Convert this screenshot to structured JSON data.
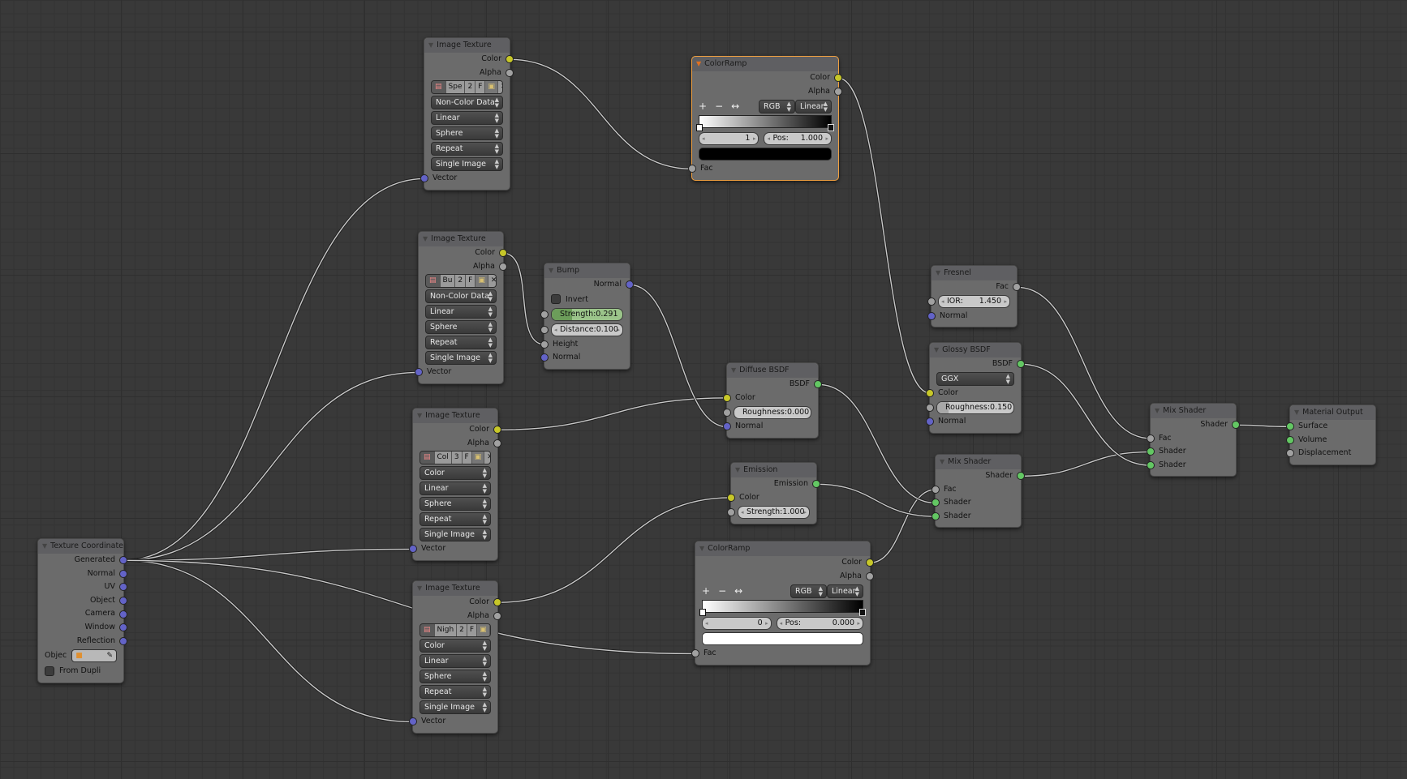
{
  "editor": "Node Editor",
  "socket_colors": {
    "color": "#c7c729",
    "float": "#a1a1a1",
    "vector": "#6363c7",
    "shader": "#63c763"
  },
  "accent_selected": "#f0a040",
  "nodes": [
    {
      "id": "img1",
      "title": "Image Texture",
      "selected": false,
      "rows": [
        {
          "kind": "out",
          "label": "Color",
          "type": "color"
        },
        {
          "kind": "out",
          "label": "Alpha",
          "type": "float"
        },
        {
          "kind": "image",
          "name": "Spe",
          "users": "2",
          "fake": "F"
        },
        {
          "kind": "select",
          "value": "Non-Color Data"
        },
        {
          "kind": "select",
          "value": "Linear"
        },
        {
          "kind": "select",
          "value": "Sphere"
        },
        {
          "kind": "select",
          "value": "Repeat"
        },
        {
          "kind": "select",
          "value": "Single Image"
        },
        {
          "kind": "in",
          "label": "Vector",
          "type": "vector"
        }
      ]
    },
    {
      "id": "img2",
      "title": "Image Texture",
      "selected": false,
      "rows": [
        {
          "kind": "out",
          "label": "Color",
          "type": "color"
        },
        {
          "kind": "out",
          "label": "Alpha",
          "type": "float"
        },
        {
          "kind": "image",
          "name": "Bu",
          "users": "2",
          "fake": "F"
        },
        {
          "kind": "select",
          "value": "Non-Color Data"
        },
        {
          "kind": "select",
          "value": "Linear"
        },
        {
          "kind": "select",
          "value": "Sphere"
        },
        {
          "kind": "select",
          "value": "Repeat"
        },
        {
          "kind": "select",
          "value": "Single Image"
        },
        {
          "kind": "in",
          "label": "Vector",
          "type": "vector"
        }
      ]
    },
    {
      "id": "img3",
      "title": "Image Texture",
      "selected": false,
      "rows": [
        {
          "kind": "out",
          "label": "Color",
          "type": "color"
        },
        {
          "kind": "out",
          "label": "Alpha",
          "type": "float"
        },
        {
          "kind": "image",
          "name": "Col",
          "users": "3",
          "fake": "F"
        },
        {
          "kind": "select",
          "value": "Color"
        },
        {
          "kind": "select",
          "value": "Linear"
        },
        {
          "kind": "select",
          "value": "Sphere"
        },
        {
          "kind": "select",
          "value": "Repeat"
        },
        {
          "kind": "select",
          "value": "Single Image"
        },
        {
          "kind": "in",
          "label": "Vector",
          "type": "vector"
        }
      ]
    },
    {
      "id": "img4",
      "title": "Image Texture",
      "selected": false,
      "rows": [
        {
          "kind": "out",
          "label": "Color",
          "type": "color"
        },
        {
          "kind": "out",
          "label": "Alpha",
          "type": "float"
        },
        {
          "kind": "image",
          "name": "Nigh",
          "users": "2",
          "fake": "F"
        },
        {
          "kind": "select",
          "value": "Color"
        },
        {
          "kind": "select",
          "value": "Linear"
        },
        {
          "kind": "select",
          "value": "Sphere"
        },
        {
          "kind": "select",
          "value": "Repeat"
        },
        {
          "kind": "select",
          "value": "Single Image"
        },
        {
          "kind": "in",
          "label": "Vector",
          "type": "vector"
        }
      ]
    },
    {
      "id": "texcoord",
      "title": "Texture Coordinate",
      "selected": false,
      "rows": [
        {
          "kind": "out",
          "label": "Generated",
          "type": "vector"
        },
        {
          "kind": "out",
          "label": "Normal",
          "type": "vector"
        },
        {
          "kind": "out",
          "label": "UV",
          "type": "vector"
        },
        {
          "kind": "out",
          "label": "Object",
          "type": "vector"
        },
        {
          "kind": "out",
          "label": "Camera",
          "type": "vector"
        },
        {
          "kind": "out",
          "label": "Window",
          "type": "vector"
        },
        {
          "kind": "out",
          "label": "Reflection",
          "type": "vector"
        },
        {
          "kind": "object",
          "label": "Objec"
        },
        {
          "kind": "check",
          "label": "From Dupli",
          "checked": false
        }
      ]
    },
    {
      "id": "bump",
      "title": "Bump",
      "selected": false,
      "rows": [
        {
          "kind": "out",
          "label": "Normal",
          "type": "vector"
        },
        {
          "kind": "check",
          "label": "Invert",
          "checked": false
        },
        {
          "kind": "field",
          "label": "Strength:",
          "value": "0.291",
          "style": "slider",
          "fraction": 0.291,
          "highlight": true,
          "type": "float"
        },
        {
          "kind": "field",
          "label": "Distance:",
          "value": "0.100",
          "style": "number",
          "type": "float"
        },
        {
          "kind": "in",
          "label": "Height",
          "type": "float"
        },
        {
          "kind": "in",
          "label": "Normal",
          "type": "vector"
        }
      ]
    },
    {
      "id": "ramp1",
      "title": "ColorRamp",
      "selected": true,
      "rows": [
        {
          "kind": "out",
          "label": "Color",
          "type": "color"
        },
        {
          "kind": "out",
          "label": "Alpha",
          "type": "float"
        },
        {
          "kind": "ramp",
          "plus": "+",
          "minus": "−",
          "flip": "↔",
          "color_mode": "RGB",
          "interpolation": "Linear",
          "active_stop": "1",
          "pos_label": "Pos:",
          "pos": "1.000",
          "active_color": "#000000",
          "stops": [
            {
              "pos": 0,
              "color": "#ffffff"
            },
            {
              "pos": 1,
              "color": "#000000"
            }
          ]
        },
        {
          "kind": "in",
          "label": "Fac",
          "type": "float"
        }
      ]
    },
    {
      "id": "ramp2",
      "title": "ColorRamp",
      "selected": false,
      "rows": [
        {
          "kind": "out",
          "label": "Color",
          "type": "color"
        },
        {
          "kind": "out",
          "label": "Alpha",
          "type": "float"
        },
        {
          "kind": "ramp",
          "plus": "+",
          "minus": "−",
          "flip": "↔",
          "color_mode": "RGB",
          "interpolation": "Linear",
          "active_stop": "0",
          "pos_label": "Pos:",
          "pos": "0.000",
          "active_color": "#ffffff",
          "stops": [
            {
              "pos": 0,
              "color": "#ffffff"
            },
            {
              "pos": 1,
              "color": "#000000"
            }
          ]
        },
        {
          "kind": "in",
          "label": "Fac",
          "type": "float"
        }
      ]
    },
    {
      "id": "diffuse",
      "title": "Diffuse BSDF",
      "selected": false,
      "rows": [
        {
          "kind": "out",
          "label": "BSDF",
          "type": "shader"
        },
        {
          "kind": "in",
          "label": "Color",
          "type": "color"
        },
        {
          "kind": "field",
          "label": "Roughness:",
          "value": "0.000",
          "style": "slider",
          "fraction": 0.0,
          "type": "float"
        },
        {
          "kind": "in",
          "label": "Normal",
          "type": "vector"
        }
      ]
    },
    {
      "id": "emission",
      "title": "Emission",
      "selected": false,
      "rows": [
        {
          "kind": "out",
          "label": "Emission",
          "type": "shader"
        },
        {
          "kind": "in",
          "label": "Color",
          "type": "color"
        },
        {
          "kind": "field",
          "label": "Strength:",
          "value": "1.000",
          "style": "number",
          "type": "float"
        }
      ]
    },
    {
      "id": "fresnel",
      "title": "Fresnel",
      "selected": false,
      "rows": [
        {
          "kind": "out",
          "label": "Fac",
          "type": "float"
        },
        {
          "kind": "field",
          "label": "IOR:",
          "value": "1.450",
          "style": "number",
          "type": "float"
        },
        {
          "kind": "in",
          "label": "Normal",
          "type": "vector"
        }
      ]
    },
    {
      "id": "glossy",
      "title": "Glossy BSDF",
      "selected": false,
      "rows": [
        {
          "kind": "out",
          "label": "BSDF",
          "type": "shader"
        },
        {
          "kind": "select",
          "value": "GGX"
        },
        {
          "kind": "in",
          "label": "Color",
          "type": "color"
        },
        {
          "kind": "field",
          "label": "Roughness:",
          "value": "0.150",
          "style": "slider",
          "fraction": 0.15,
          "type": "float"
        },
        {
          "kind": "in",
          "label": "Normal",
          "type": "vector"
        }
      ]
    },
    {
      "id": "mix1",
      "title": "Mix Shader",
      "selected": false,
      "rows": [
        {
          "kind": "out",
          "label": "Shader",
          "type": "shader"
        },
        {
          "kind": "in",
          "label": "Fac",
          "type": "float"
        },
        {
          "kind": "in",
          "label": "Shader",
          "type": "shader"
        },
        {
          "kind": "in",
          "label": "Shader",
          "type": "shader"
        }
      ]
    },
    {
      "id": "mix2",
      "title": "Mix Shader",
      "selected": false,
      "rows": [
        {
          "kind": "out",
          "label": "Shader",
          "type": "shader"
        },
        {
          "kind": "in",
          "label": "Fac",
          "type": "float"
        },
        {
          "kind": "in",
          "label": "Shader",
          "type": "shader"
        },
        {
          "kind": "in",
          "label": "Shader",
          "type": "shader"
        }
      ]
    },
    {
      "id": "output",
      "title": "Material Output",
      "selected": false,
      "rows": [
        {
          "kind": "in",
          "label": "Surface",
          "type": "shader"
        },
        {
          "kind": "in",
          "label": "Volume",
          "type": "shader"
        },
        {
          "kind": "in",
          "label": "Displacement",
          "type": "float"
        }
      ]
    }
  ],
  "links": [
    {
      "from": "texcoord",
      "out": 0,
      "to": "img1",
      "in": 0
    },
    {
      "from": "texcoord",
      "out": 0,
      "to": "img2",
      "in": 0
    },
    {
      "from": "texcoord",
      "out": 0,
      "to": "img3",
      "in": 0
    },
    {
      "from": "texcoord",
      "out": 0,
      "to": "img4",
      "in": 0
    },
    {
      "from": "texcoord",
      "out": 0,
      "to": "ramp2",
      "in": 0
    },
    {
      "from": "img1",
      "out": 0,
      "to": "ramp1",
      "in": 0
    },
    {
      "from": "img2",
      "out": 0,
      "to": "bump",
      "in": 2
    },
    {
      "from": "img3",
      "out": 0,
      "to": "diffuse",
      "in": 0
    },
    {
      "from": "img4",
      "out": 0,
      "to": "emission",
      "in": 0
    },
    {
      "from": "bump",
      "out": 0,
      "to": "diffuse",
      "in": 2
    },
    {
      "from": "ramp1",
      "out": 0,
      "to": "glossy",
      "in": 0
    },
    {
      "from": "ramp2",
      "out": 0,
      "to": "mix1",
      "in": 0
    },
    {
      "from": "diffuse",
      "out": 0,
      "to": "mix1",
      "in": 1
    },
    {
      "from": "emission",
      "out": 0,
      "to": "mix1",
      "in": 2
    },
    {
      "from": "fresnel",
      "out": 0,
      "to": "mix2",
      "in": 0
    },
    {
      "from": "mix1",
      "out": 0,
      "to": "mix2",
      "in": 1
    },
    {
      "from": "glossy",
      "out": 0,
      "to": "mix2",
      "in": 2
    },
    {
      "from": "mix2",
      "out": 0,
      "to": "output",
      "in": 0
    }
  ]
}
